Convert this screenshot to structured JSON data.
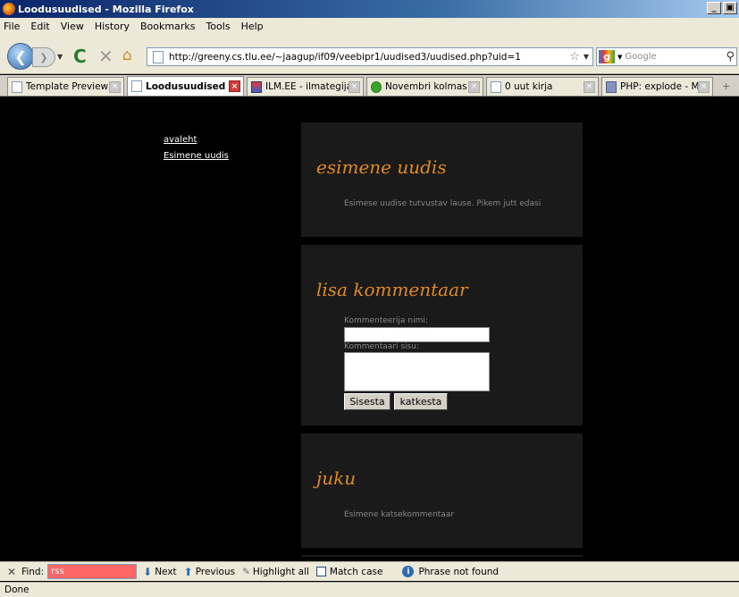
{
  "window": {
    "title": "Loodusuudised - Mozilla Firefox",
    "buttons": [
      "_",
      "\u0000"
    ]
  },
  "menu": [
    "File",
    "Edit",
    "View",
    "History",
    "Bookmarks",
    "Tools",
    "Help"
  ],
  "nav": {
    "url": "http://greeny.cs.tlu.ee/~jaagup/if09/veebipr1/uudised3/uudised.php?uid=1",
    "search_placeholder": "Google"
  },
  "tabs": [
    {
      "label": "Template Preview (b...",
      "icon": "page-icon"
    },
    {
      "label": "Loodusuudised",
      "icon": "page-icon",
      "active": true
    },
    {
      "label": "ILM.EE - ilmategija in...",
      "icon": "ilm-icon"
    },
    {
      "label": "Novembri kolmas näd...",
      "icon": "green-circle-icon"
    },
    {
      "label": "0 uut kirja",
      "icon": "page-icon"
    },
    {
      "label": "PHP: explode - Manual",
      "icon": "php-icon"
    }
  ],
  "page": {
    "nav_links": [
      "avaleht",
      "Esimene uudis"
    ],
    "news": {
      "title": "esimene uudis",
      "summary": "Esimese uudise tutvustav lause. Pikem jutt edasi"
    },
    "comment_form": {
      "title": "lisa kommentaar",
      "name_label": "Kommenteerija nimi:",
      "body_label": "Kommentaari sisu:",
      "submit": "Sisesta",
      "cancel": "katkesta"
    },
    "comment": {
      "author": "juku",
      "text": "Esimene katsekommentaar"
    }
  },
  "findbar": {
    "label": "Find:",
    "query": "rss",
    "next": "Next",
    "previous": "Previous",
    "highlight": "Highlight all",
    "match_case": "Match case",
    "status": "Phrase not found"
  },
  "status": "Done",
  "colors": {
    "accent": "#e08a20",
    "panel": "#1a1a1a",
    "find_error": "#ff6666"
  }
}
